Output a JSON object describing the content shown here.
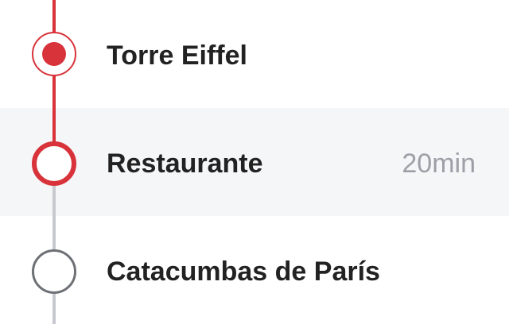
{
  "stops": [
    {
      "name": "Torre Eiffel",
      "state": "visited",
      "icon": "filled-dot-icon"
    },
    {
      "name": "Restaurante",
      "state": "current",
      "duration": "20min",
      "icon": "ring-icon"
    },
    {
      "name": "Catacumbas de París",
      "state": "upcoming",
      "icon": "hollow-circle-icon"
    }
  ],
  "colors": {
    "accent": "#d8333a",
    "inactive_line": "#c7c9ce",
    "inactive_node": "#6d7075",
    "highlight_row": "#f5f6f8",
    "text": "#222222",
    "muted_text": "#9ca0a6"
  }
}
